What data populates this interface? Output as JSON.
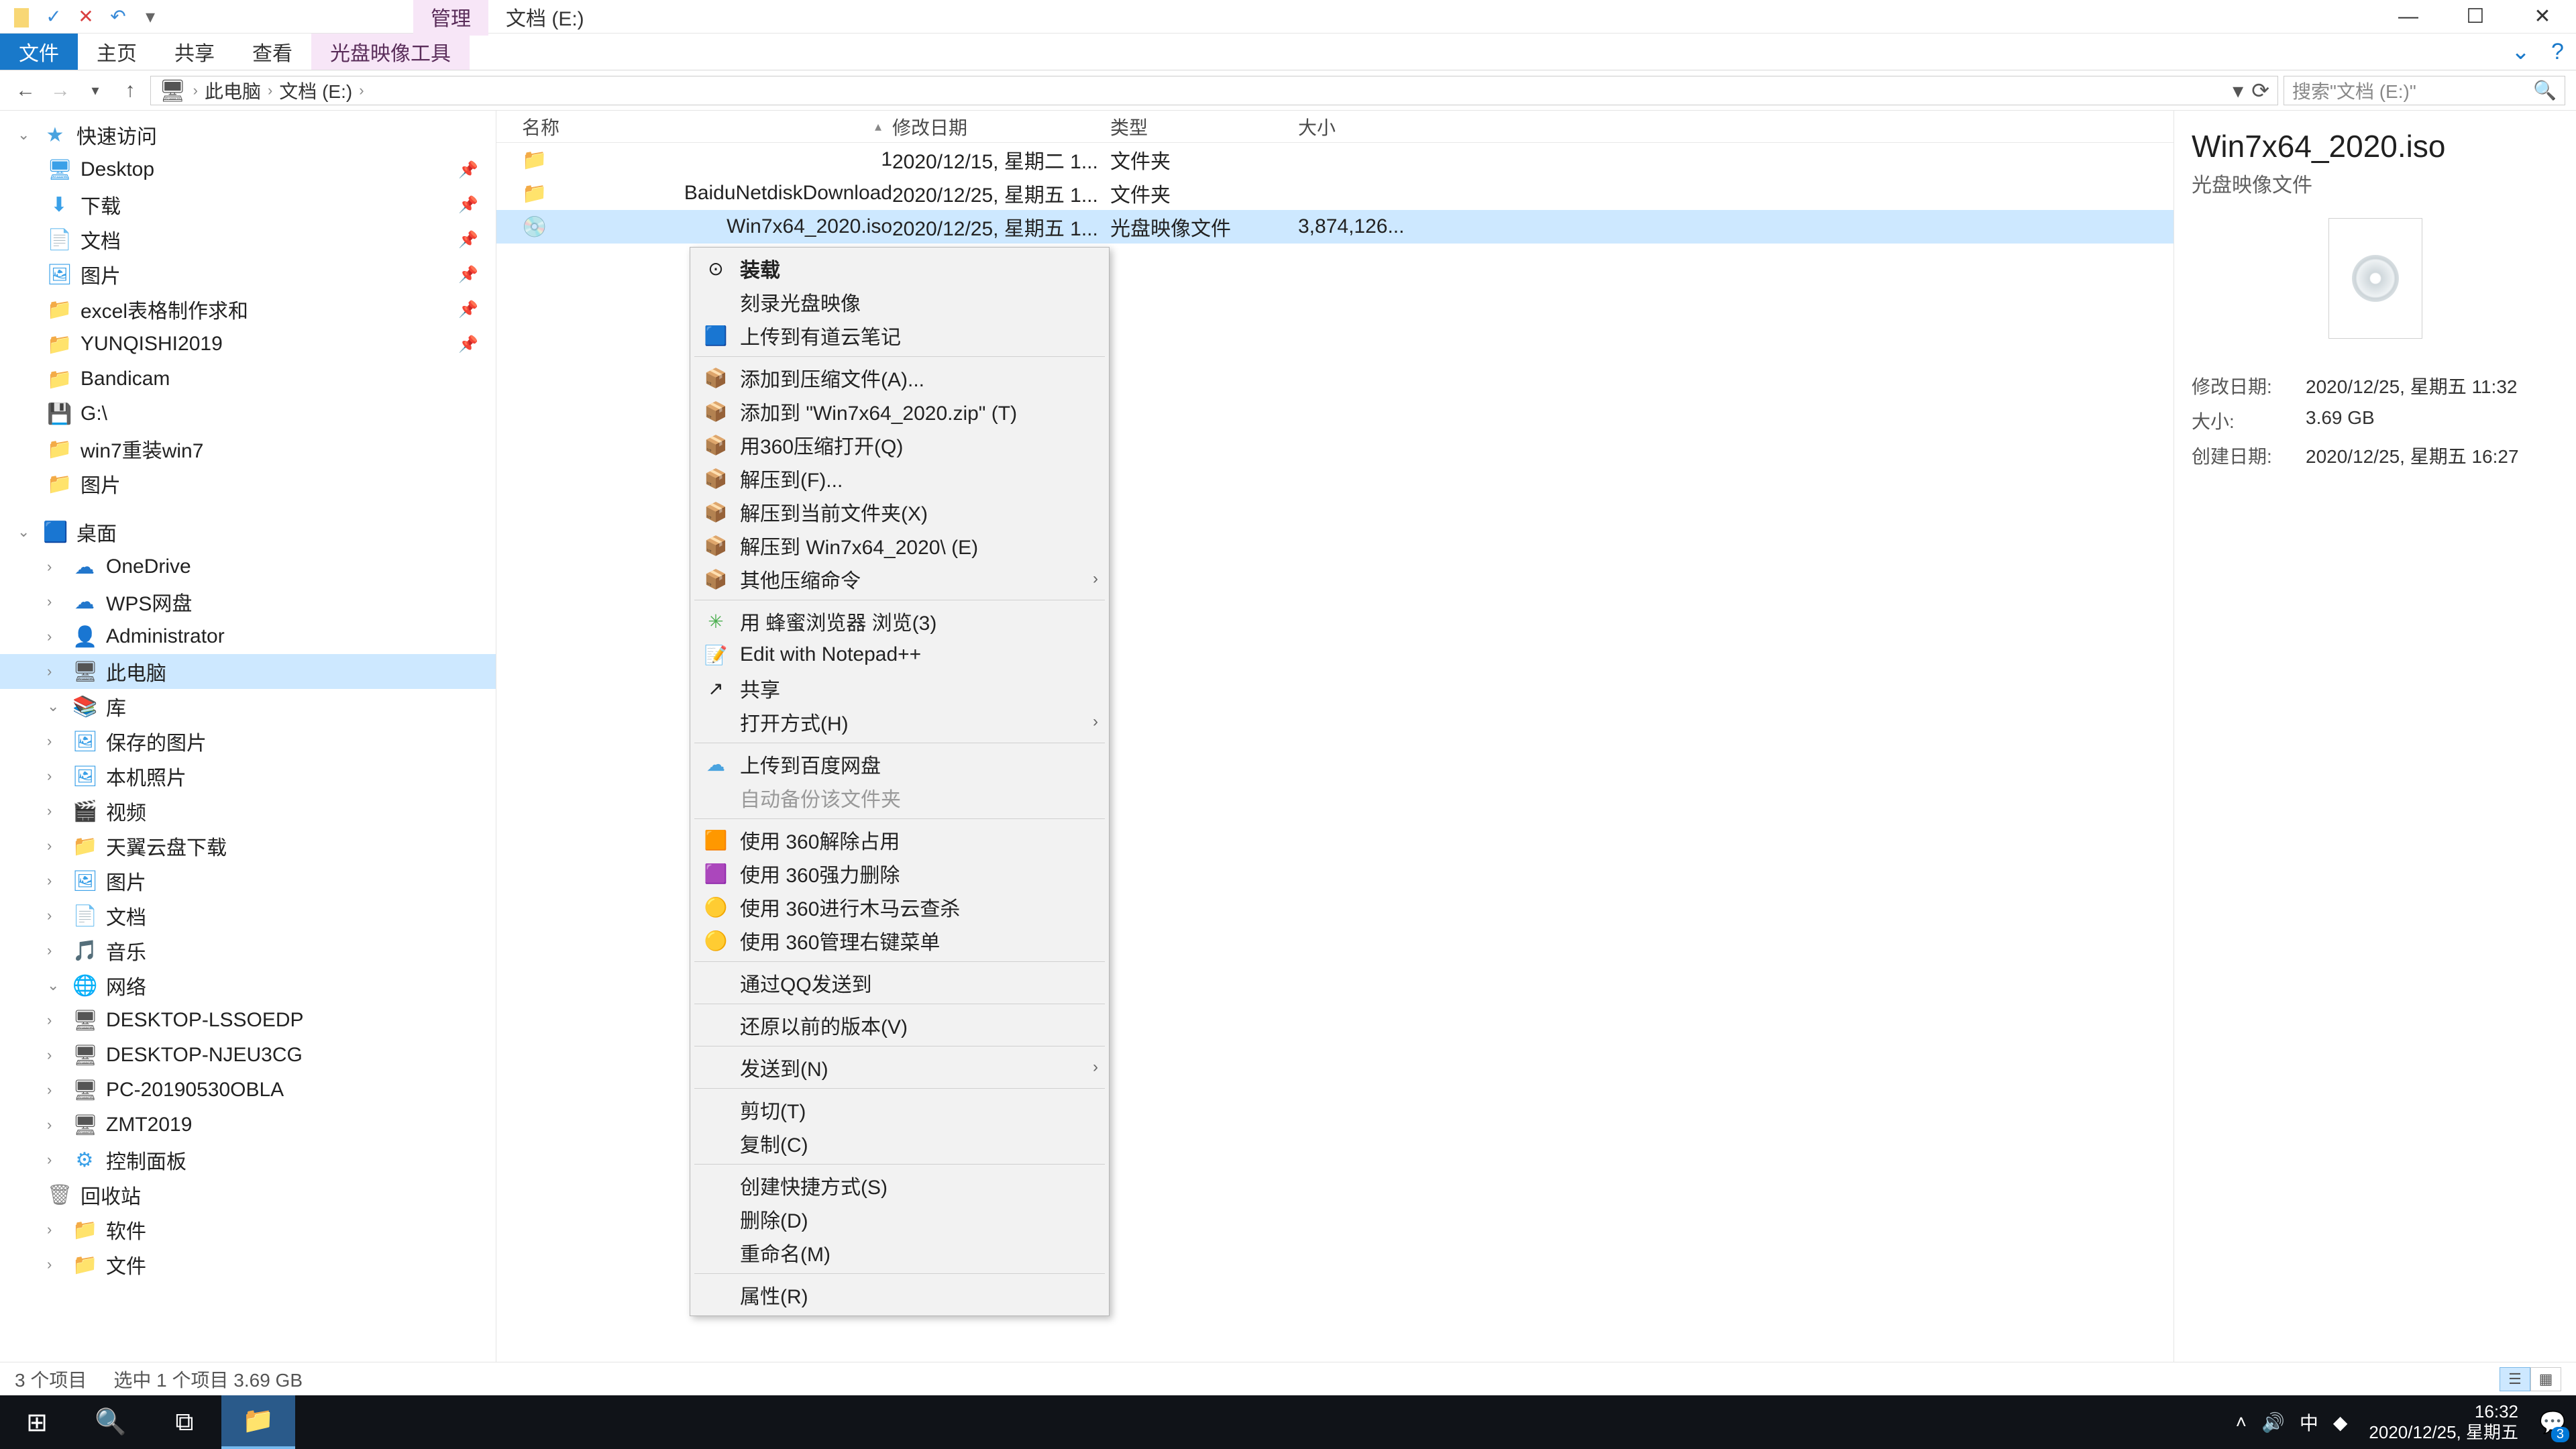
{
  "titlebar": {
    "context_tab": "管理",
    "title": "文档 (E:)"
  },
  "ribbon": {
    "file": "文件",
    "home": "主页",
    "share": "共享",
    "view": "查看",
    "disc_tools": "光盘映像工具"
  },
  "breadcrumb": {
    "pc": "此电脑",
    "drive": "文档 (E:)"
  },
  "search_placeholder": "搜索\"文档 (E:)\"",
  "columns": {
    "name": "名称",
    "date": "修改日期",
    "type": "类型",
    "size": "大小"
  },
  "files": [
    {
      "icon": "folder",
      "name": "1",
      "date": "2020/12/15, 星期二 1...",
      "type": "文件夹",
      "size": ""
    },
    {
      "icon": "folder",
      "name": "BaiduNetdiskDownload",
      "date": "2020/12/25, 星期五 1...",
      "type": "文件夹",
      "size": ""
    },
    {
      "icon": "disc",
      "name": "Win7x64_2020.iso",
      "date": "2020/12/25, 星期五 1...",
      "type": "光盘映像文件",
      "size": "3,874,126..."
    }
  ],
  "nav": {
    "quick": "快速访问",
    "desktop": "Desktop",
    "downloads": "下载",
    "documents": "文档",
    "pictures": "图片",
    "excel": "excel表格制作求和",
    "yunqishi": "YUNQISHI2019",
    "bandicam": "Bandicam",
    "g_drive": "G:\\",
    "win7": "win7重装win7",
    "pictures2": "图片",
    "desktop_zh": "桌面",
    "onedrive": "OneDrive",
    "wps": "WPS网盘",
    "admin": "Administrator",
    "thispc": "此电脑",
    "library": "库",
    "saved_pics": "保存的图片",
    "local_pics": "本机照片",
    "video": "视频",
    "tianyi": "天翼云盘下载",
    "pics3": "图片",
    "docs3": "文档",
    "music": "音乐",
    "network": "网络",
    "pc1": "DESKTOP-LSSOEDP",
    "pc2": "DESKTOP-NJEU3CG",
    "pc3": "PC-20190530OBLA",
    "pc4": "ZMT2019",
    "ctrlpanel": "控制面板",
    "recycle": "回收站",
    "software": "软件",
    "files": "文件"
  },
  "details": {
    "title": "Win7x64_2020.iso",
    "subtitle": "光盘映像文件",
    "mod_label": "修改日期:",
    "mod_value": "2020/12/25, 星期五 11:32",
    "size_label": "大小:",
    "size_value": "3.69 GB",
    "created_label": "创建日期:",
    "created_value": "2020/12/25, 星期五 16:27"
  },
  "status": {
    "count": "3 个项目",
    "selection": "选中 1 个项目  3.69 GB"
  },
  "context_menu": [
    {
      "icon": "⊙",
      "label": "装载",
      "bold": true
    },
    {
      "icon": "",
      "label": "刻录光盘映像"
    },
    {
      "icon": "🟦",
      "label": "上传到有道云笔记",
      "color": "#3a7bd5"
    },
    {
      "sep": true
    },
    {
      "icon": "📦",
      "label": "添加到压缩文件(A)..."
    },
    {
      "icon": "📦",
      "label": "添加到 \"Win7x64_2020.zip\" (T)"
    },
    {
      "icon": "📦",
      "label": "用360压缩打开(Q)"
    },
    {
      "icon": "📦",
      "label": "解压到(F)..."
    },
    {
      "icon": "📦",
      "label": "解压到当前文件夹(X)"
    },
    {
      "icon": "📦",
      "label": "解压到 Win7x64_2020\\ (E)"
    },
    {
      "icon": "📦",
      "label": "其他压缩命令",
      "submenu": true
    },
    {
      "sep": true
    },
    {
      "icon": "✳",
      "label": "用 蜂蜜浏览器 浏览(3)",
      "color": "#4caf50"
    },
    {
      "icon": "📝",
      "label": "Edit with Notepad++"
    },
    {
      "icon": "↗",
      "label": "共享"
    },
    {
      "icon": "",
      "label": "打开方式(H)",
      "submenu": true
    },
    {
      "sep": true
    },
    {
      "icon": "☁",
      "label": "上传到百度网盘",
      "color": "#4aa3df"
    },
    {
      "icon": "",
      "label": "自动备份该文件夹",
      "disabled": true
    },
    {
      "sep": true
    },
    {
      "icon": "🟧",
      "label": "使用 360解除占用"
    },
    {
      "icon": "🟪",
      "label": "使用 360强力删除"
    },
    {
      "icon": "🟡",
      "label": "使用 360进行木马云查杀"
    },
    {
      "icon": "🟡",
      "label": "使用 360管理右键菜单"
    },
    {
      "sep": true
    },
    {
      "icon": "",
      "label": "通过QQ发送到"
    },
    {
      "sep": true
    },
    {
      "icon": "",
      "label": "还原以前的版本(V)"
    },
    {
      "sep": true
    },
    {
      "icon": "",
      "label": "发送到(N)",
      "submenu": true
    },
    {
      "sep": true
    },
    {
      "icon": "",
      "label": "剪切(T)"
    },
    {
      "icon": "",
      "label": "复制(C)"
    },
    {
      "sep": true
    },
    {
      "icon": "",
      "label": "创建快捷方式(S)"
    },
    {
      "icon": "",
      "label": "删除(D)"
    },
    {
      "icon": "",
      "label": "重命名(M)"
    },
    {
      "sep": true
    },
    {
      "icon": "",
      "label": "属性(R)"
    }
  ],
  "taskbar": {
    "time": "16:32",
    "date": "2020/12/25, 星期五",
    "ime": "中",
    "notif_count": "3"
  }
}
